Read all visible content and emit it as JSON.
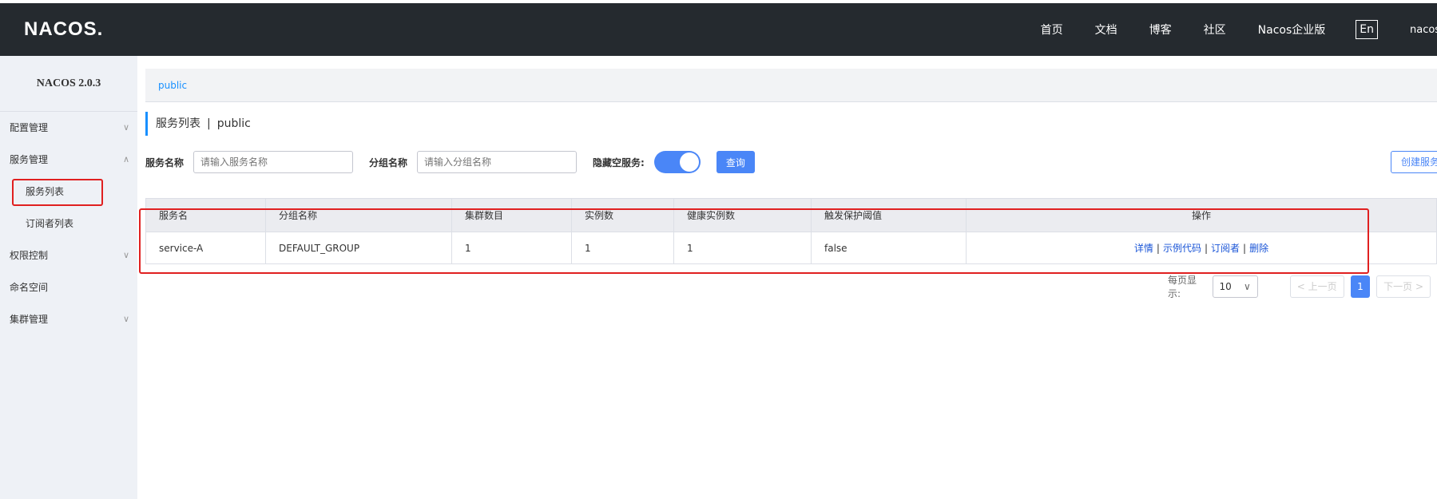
{
  "header": {
    "logo": "NACOS.",
    "nav": [
      "首页",
      "文档",
      "博客",
      "社区",
      "Nacos企业版"
    ],
    "lang": "En",
    "user": "nacos"
  },
  "sidebar": {
    "title": "NACOS 2.0.3",
    "items": [
      {
        "label": "配置管理",
        "chevron": "v"
      },
      {
        "label": "服务管理",
        "chevron": "^"
      },
      {
        "label": "服务列表"
      },
      {
        "label": "订阅者列表"
      },
      {
        "label": "权限控制",
        "chevron": "v"
      },
      {
        "label": "命名空间"
      },
      {
        "label": "集群管理",
        "chevron": "v"
      }
    ]
  },
  "breadcrumb": {
    "namespace": "public"
  },
  "page": {
    "title": "服务列表",
    "separator": "|",
    "namespace": "public"
  },
  "filters": {
    "service_label": "服务名称",
    "service_placeholder": "请输入服务名称",
    "group_label": "分组名称",
    "group_placeholder": "请输入分组名称",
    "hide_empty_label": "隐藏空服务:",
    "hide_empty_on": true,
    "query_button": "查询",
    "create_button": "创建服务"
  },
  "table": {
    "columns": [
      "服务名",
      "分组名称",
      "集群数目",
      "实例数",
      "健康实例数",
      "触发保护阈值",
      "操作"
    ],
    "rows": [
      {
        "service": "service-A",
        "group": "DEFAULT_GROUP",
        "clusters": "1",
        "instances": "1",
        "healthy": "1",
        "threshold": "false"
      }
    ],
    "ops": [
      "详情",
      "示例代码",
      "订阅者",
      "删除"
    ],
    "op_separator": "|"
  },
  "pagination": {
    "page_size_label": "每页显示:",
    "page_size": "10",
    "prev": "< 上一页",
    "current": "1",
    "next": "下一页 >"
  }
}
